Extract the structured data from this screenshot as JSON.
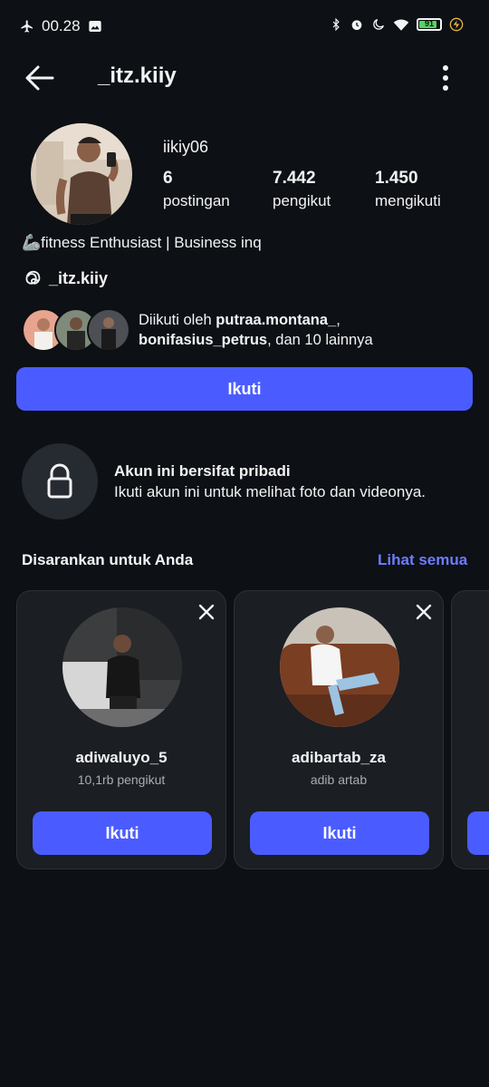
{
  "status_bar": {
    "time": "00.28",
    "battery": "91"
  },
  "header": {
    "title": "_itz.kiiy"
  },
  "profile": {
    "display_name": "iikiy06",
    "stats": [
      {
        "value": "6",
        "label": "postingan"
      },
      {
        "value": "7.442",
        "label": "pengikut"
      },
      {
        "value": "1.450",
        "label": "mengikuti"
      }
    ],
    "bio": "🦾fitness Enthusiast | Business inq",
    "threads_handle": "_itz.kiiy",
    "followed_by_prefix": "Diikuti oleh ",
    "followed_by_user1": "putraa.montana_",
    "followed_by_sep": ",",
    "followed_by_user2": "bonifasius_petrus",
    "followed_by_suffix": ", dan 10 lainnya",
    "follow_label": "Ikuti"
  },
  "private": {
    "title": "Akun ini bersifat pribadi",
    "subtitle": "Ikuti akun ini untuk melihat foto dan videonya."
  },
  "suggestions": {
    "title": "Disarankan untuk Anda",
    "see_all": "Lihat semua",
    "cards": [
      {
        "username": "adiwaluyo_5",
        "subtitle": "10,1rb pengikut",
        "button": "Ikuti"
      },
      {
        "username": "adibartab_za",
        "subtitle": "adib artab",
        "button": "Ikuti"
      }
    ]
  },
  "colors": {
    "accent": "#4a5cff",
    "link": "#6d7dff",
    "background": "#0d1014"
  }
}
